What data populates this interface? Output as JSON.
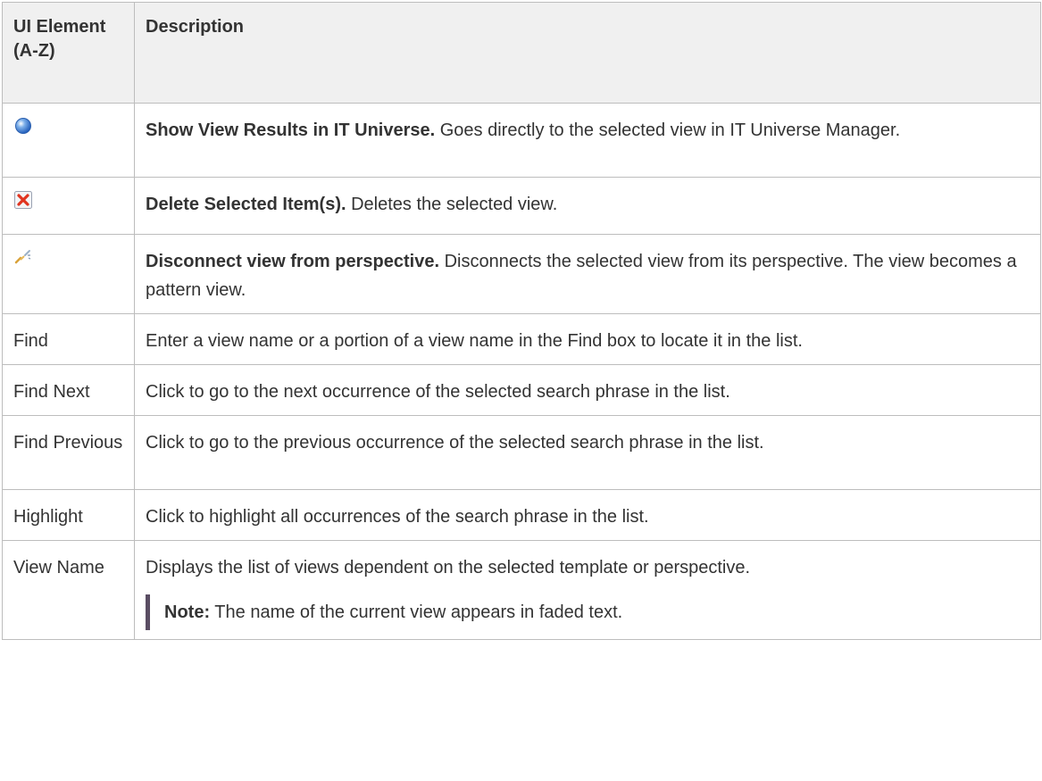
{
  "header": {
    "col1": "UI Element (A-Z)",
    "col2": "Description"
  },
  "rows": [
    {
      "icon": "globe-icon",
      "title": "Show View Results in IT Universe.",
      "desc": " Goes directly to the selected view in IT Universe Manager."
    },
    {
      "icon": "delete-icon",
      "title": "Delete Selected Item(s).",
      "desc": " Deletes the selected view."
    },
    {
      "icon": "disconnect-icon",
      "title": "Disconnect view from perspective.",
      "desc": " Disconnects the selected view from its perspective. The view becomes a pattern view."
    },
    {
      "label": "Find",
      "desc": "Enter a view name or a portion of a view name in the Find box to locate it in the list."
    },
    {
      "label": "Find Next",
      "desc": "Click to go to the next occurrence of the selected search phrase in the list."
    },
    {
      "label": "Find Previous",
      "desc": "Click to go to the previous occurrence of the selected search phrase in the list."
    },
    {
      "label": "Highlight",
      "desc": "Click to highlight all occurrences of the search phrase in the list."
    },
    {
      "label": "View Name",
      "desc": "Displays the list of views dependent on the selected template or perspective.",
      "note_label": "Note:",
      "note_text": "  The name of the current view appears in faded text."
    }
  ]
}
